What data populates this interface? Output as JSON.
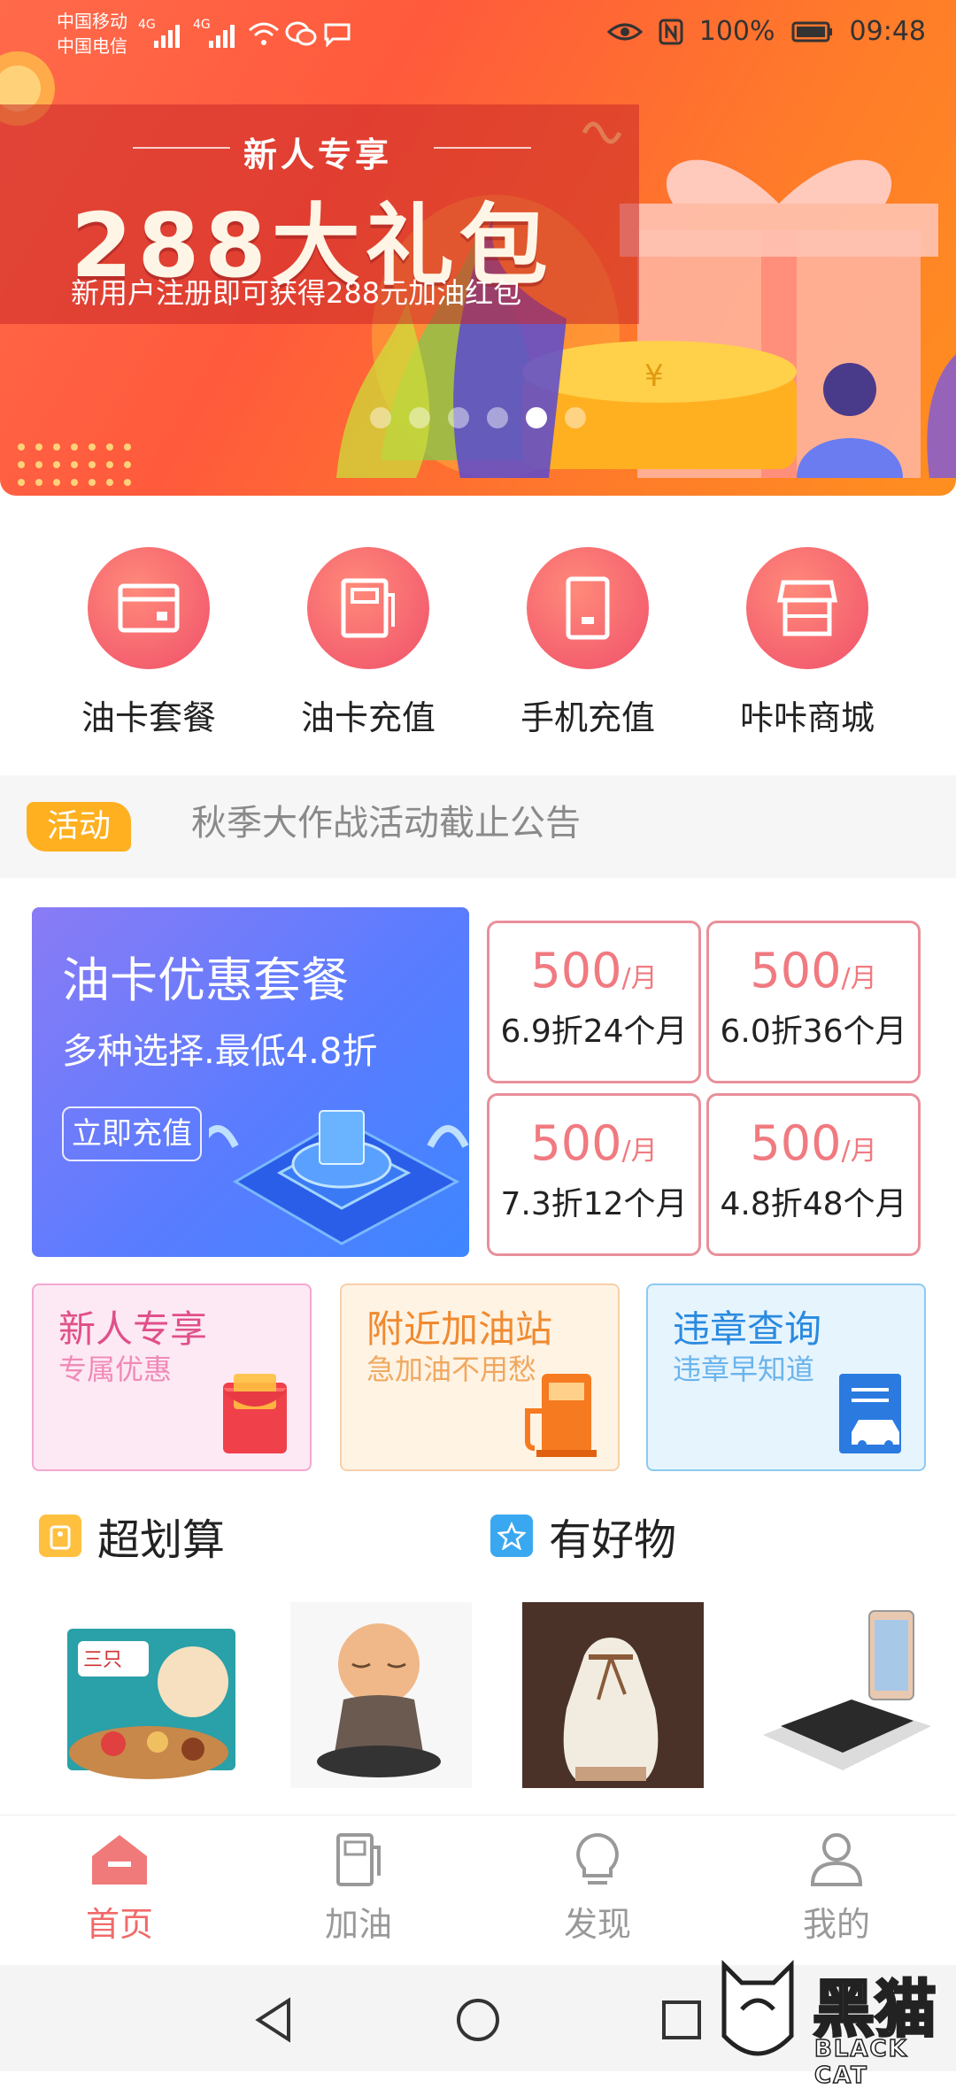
{
  "status_bar": {
    "carrier1": "中国移动",
    "carrier2": "中国电信",
    "net1": "4G",
    "net2": "4G",
    "battery": "100%",
    "time": "09:48"
  },
  "banner": {
    "subtitle": "新人专享",
    "title": "288大礼包",
    "description": "新用户注册即可获得288元加油红包",
    "dot_count": 6,
    "active_dot": 4
  },
  "quick_entries": [
    {
      "label": "油卡套餐",
      "icon": "card-icon"
    },
    {
      "label": "油卡充值",
      "icon": "fuel-recharge-icon"
    },
    {
      "label": "手机充值",
      "icon": "phone-icon"
    },
    {
      "label": "咔咔商城",
      "icon": "store-icon"
    }
  ],
  "notice": {
    "tag": "活动",
    "text": "秋季大作战活动截止公告"
  },
  "package_card": {
    "title": "油卡优惠套餐",
    "subtitle": "多种选择.最低4.8折",
    "button": "立即充值"
  },
  "price_options": [
    {
      "amount": "500",
      "unit": "/月",
      "desc": "6.9折24个月"
    },
    {
      "amount": "500",
      "unit": "/月",
      "desc": "6.0折36个月"
    },
    {
      "amount": "500",
      "unit": "/月",
      "desc": "7.3折12个月"
    },
    {
      "amount": "500",
      "unit": "/月",
      "desc": "4.8折48个月"
    }
  ],
  "feature_cards": [
    {
      "title": "新人专享",
      "subtitle": "专属优惠",
      "color": "#e0508a",
      "bg": "#fde9f4",
      "border": "#f2a8d0"
    },
    {
      "title": "附近加油站",
      "subtitle": "急加油不用愁",
      "color": "#f08a30",
      "bg": "#fff3e4",
      "border": "#f6d0a8"
    },
    {
      "title": "违章查询",
      "subtitle": "违章早知道",
      "color": "#2a8ae0",
      "bg": "#e6f4fd",
      "border": "#8ccaf0"
    }
  ],
  "sections": [
    {
      "title": "超划算"
    },
    {
      "title": "有好物"
    }
  ],
  "products": [
    {
      "name": "snack-box-product"
    },
    {
      "name": "monk-figurine-product"
    },
    {
      "name": "aroma-diffuser-product"
    },
    {
      "name": "phone-stand-product"
    }
  ],
  "tabs": [
    {
      "label": "首页",
      "icon": "home-icon"
    },
    {
      "label": "加油",
      "icon": "fuel-icon"
    },
    {
      "label": "发现",
      "icon": "bulb-icon"
    },
    {
      "label": "我的",
      "icon": "user-icon"
    }
  ],
  "watermark": {
    "text_cn": "黑猫",
    "text_en": "BLACK CAT"
  },
  "colors": {
    "accent": "#f06a6a",
    "price": "#f07a80",
    "notice_tag": "#ffb020"
  }
}
